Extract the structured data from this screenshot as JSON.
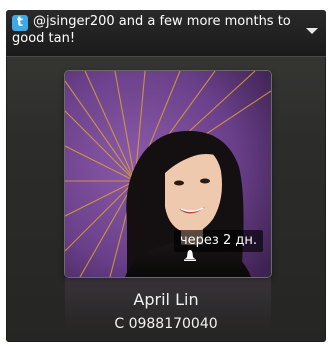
{
  "status": {
    "service_icon": "twitter-icon",
    "message": "@jsinger200 and a few more months to good tan!",
    "menu_icon": "dropdown-chevron-icon"
  },
  "photo": {
    "timestamp": "через 2 дн.",
    "timestamp_icon": "bell-icon",
    "background_color": "#6a3f8a",
    "ray_color": "#d9a232"
  },
  "contact": {
    "name": "April Lin",
    "phone": "C 0988170040"
  },
  "colors": {
    "twitter_blue": "#3fa9e8",
    "widget_bg": "#2c2c2a",
    "text": "#ffffff"
  }
}
